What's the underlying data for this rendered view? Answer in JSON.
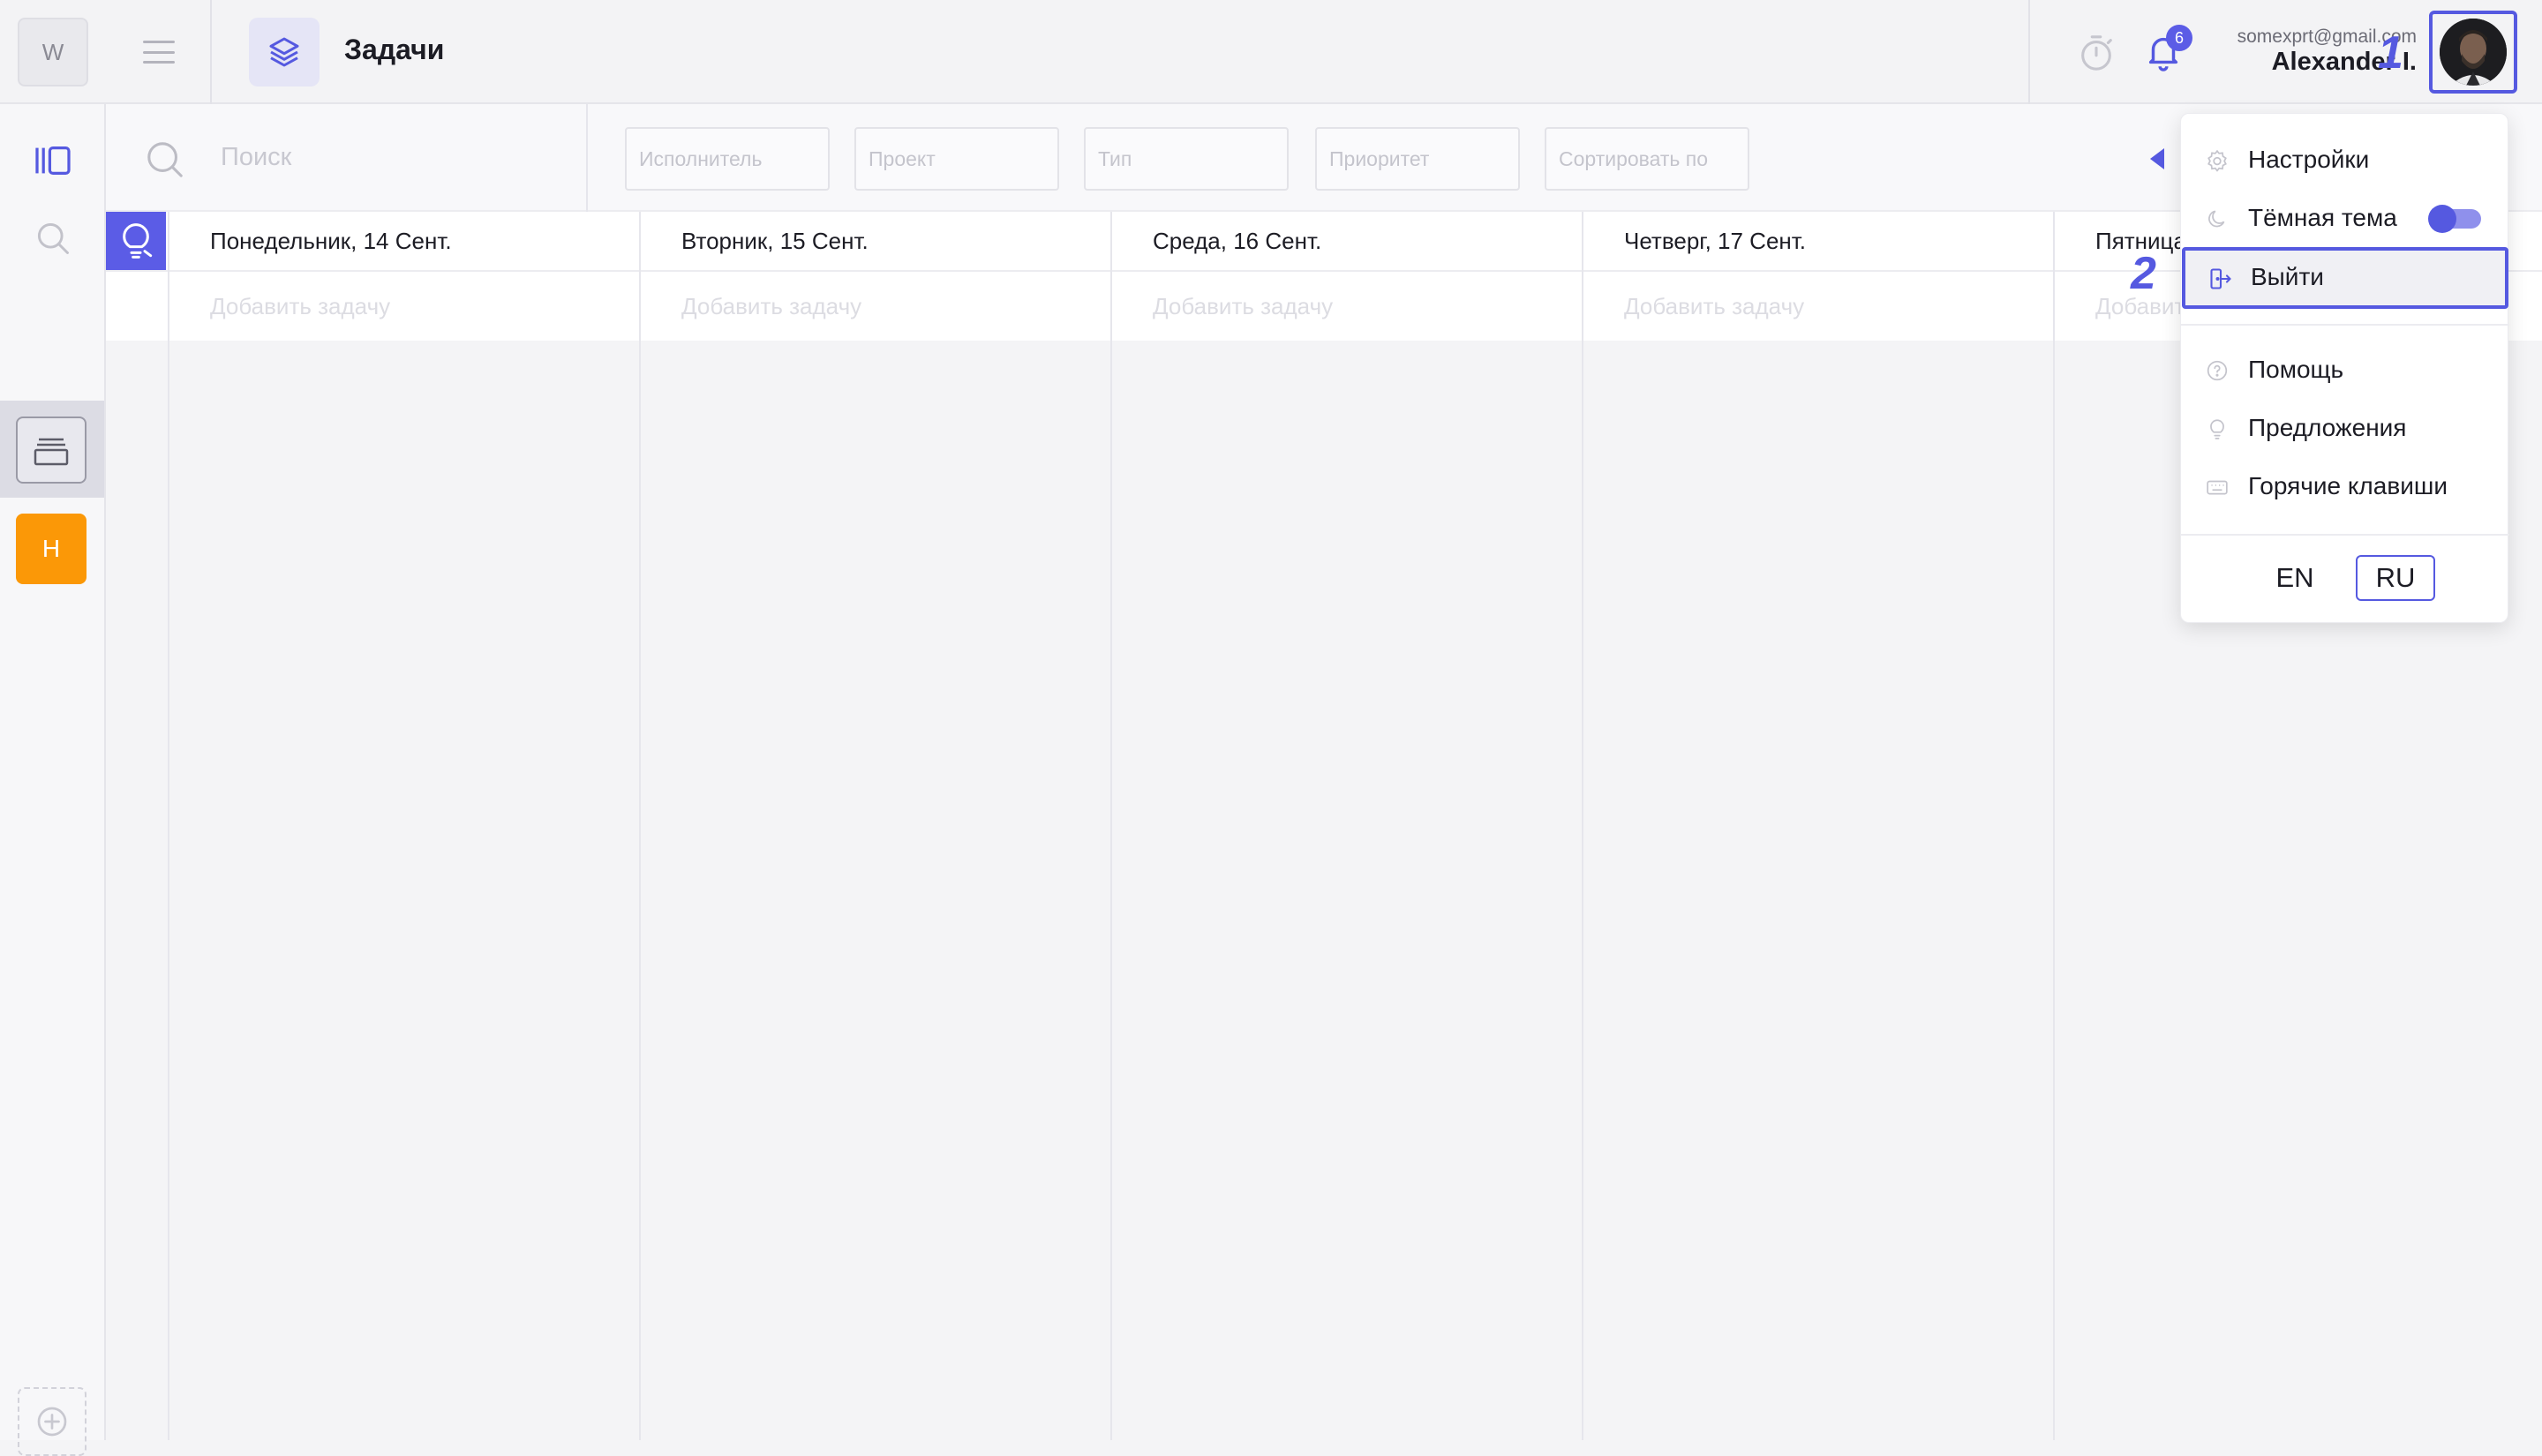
{
  "header": {
    "workspace_initial": "W",
    "title": "Задачи",
    "notifications_count": "6",
    "user_email": "somexprt@gmail.com",
    "user_name": "Alexander I."
  },
  "rail": {
    "project_initial": "Н"
  },
  "filters": {
    "search_placeholder": "Поиск",
    "assignee": "Исполнитель",
    "project": "Проект",
    "type": "Тип",
    "priority": "Приоритет",
    "sort": "Сортировать по"
  },
  "board": {
    "add_task_label": "Добавить задачу",
    "days": [
      {
        "label": "Понедельник, 14 Сент."
      },
      {
        "label": "Вторник, 15 Сент."
      },
      {
        "label": "Среда, 16 Сент."
      },
      {
        "label": "Четверг, 17 Сент."
      },
      {
        "label": "Пятница"
      }
    ]
  },
  "menu": {
    "settings": "Настройки",
    "dark_theme": "Тёмная тема",
    "dark_theme_on": true,
    "logout": "Выйти",
    "help": "Помощь",
    "suggestions": "Предложения",
    "hotkeys": "Горячие клавиши",
    "lang_en": "EN",
    "lang_ru": "RU",
    "active_lang": "RU"
  },
  "steps": {
    "step1": "1",
    "step2": "2"
  },
  "colors": {
    "accent": "#5559e0",
    "project_badge": "#fb9807"
  }
}
